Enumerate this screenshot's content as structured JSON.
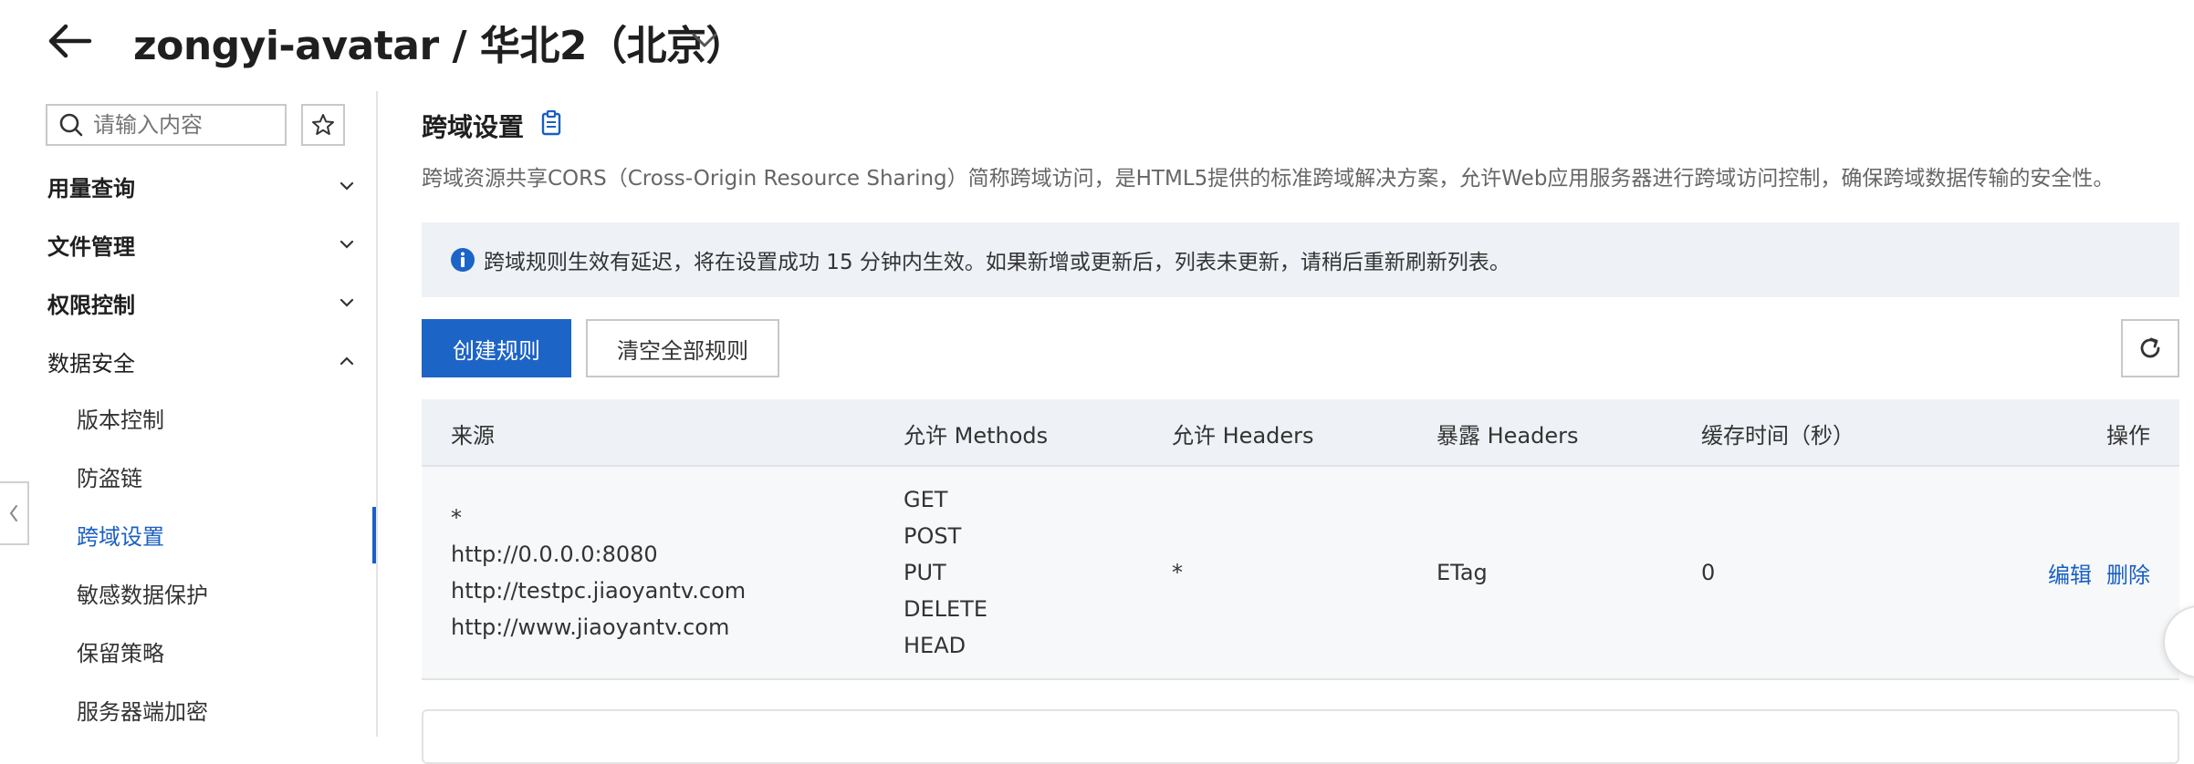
{
  "header": {
    "title": "zongyi-avatar / 华北2（北京）",
    "back_icon": "arrow-left-icon",
    "dropdown_icon": "chevron-down-icon"
  },
  "sidebar": {
    "search_placeholder": "请输入内容",
    "groups": [
      {
        "label": "用量查询",
        "expanded": false
      },
      {
        "label": "文件管理",
        "expanded": false
      },
      {
        "label": "权限控制",
        "expanded": false
      },
      {
        "label": "数据安全",
        "expanded": true
      }
    ],
    "sub_items": [
      {
        "label": "版本控制"
      },
      {
        "label": "防盗链"
      },
      {
        "label": "跨域设置",
        "active": true
      },
      {
        "label": "敏感数据保护"
      },
      {
        "label": "保留策略"
      },
      {
        "label": "服务器端加密"
      }
    ]
  },
  "main": {
    "title": "跨域设置",
    "description": "跨域资源共享CORS（Cross-Origin Resource Sharing）简称跨域访问，是HTML5提供的标准跨域解决方案，允许Web应用服务器进行跨域访问控制，确保跨域数据传输的安全性。",
    "notice": "跨域规则生效有延迟，将在设置成功 15 分钟内生效。如果新增或更新后，列表未更新，请稍后重新刷新列表。",
    "buttons": {
      "create": "创建规则",
      "clear_all": "清空全部规则"
    },
    "table": {
      "columns": [
        "来源",
        "允许 Methods",
        "允许 Headers",
        "暴露 Headers",
        "缓存时间（秒）",
        "操作"
      ],
      "rows": [
        {
          "origins": [
            "*",
            "http://0.0.0.0:8080",
            "http://testpc.jiaoyantv.com",
            "http://www.jiaoyantv.com"
          ],
          "methods": [
            "GET",
            "POST",
            "PUT",
            "DELETE",
            "HEAD"
          ],
          "allow_headers": "*",
          "expose_headers": "ETag",
          "max_age": "0",
          "actions": {
            "edit": "编辑",
            "delete": "删除"
          }
        }
      ]
    }
  },
  "colors": {
    "accent": "#1d64c7",
    "link": "#1a5fc2",
    "notice_bg": "#eef2f7"
  }
}
